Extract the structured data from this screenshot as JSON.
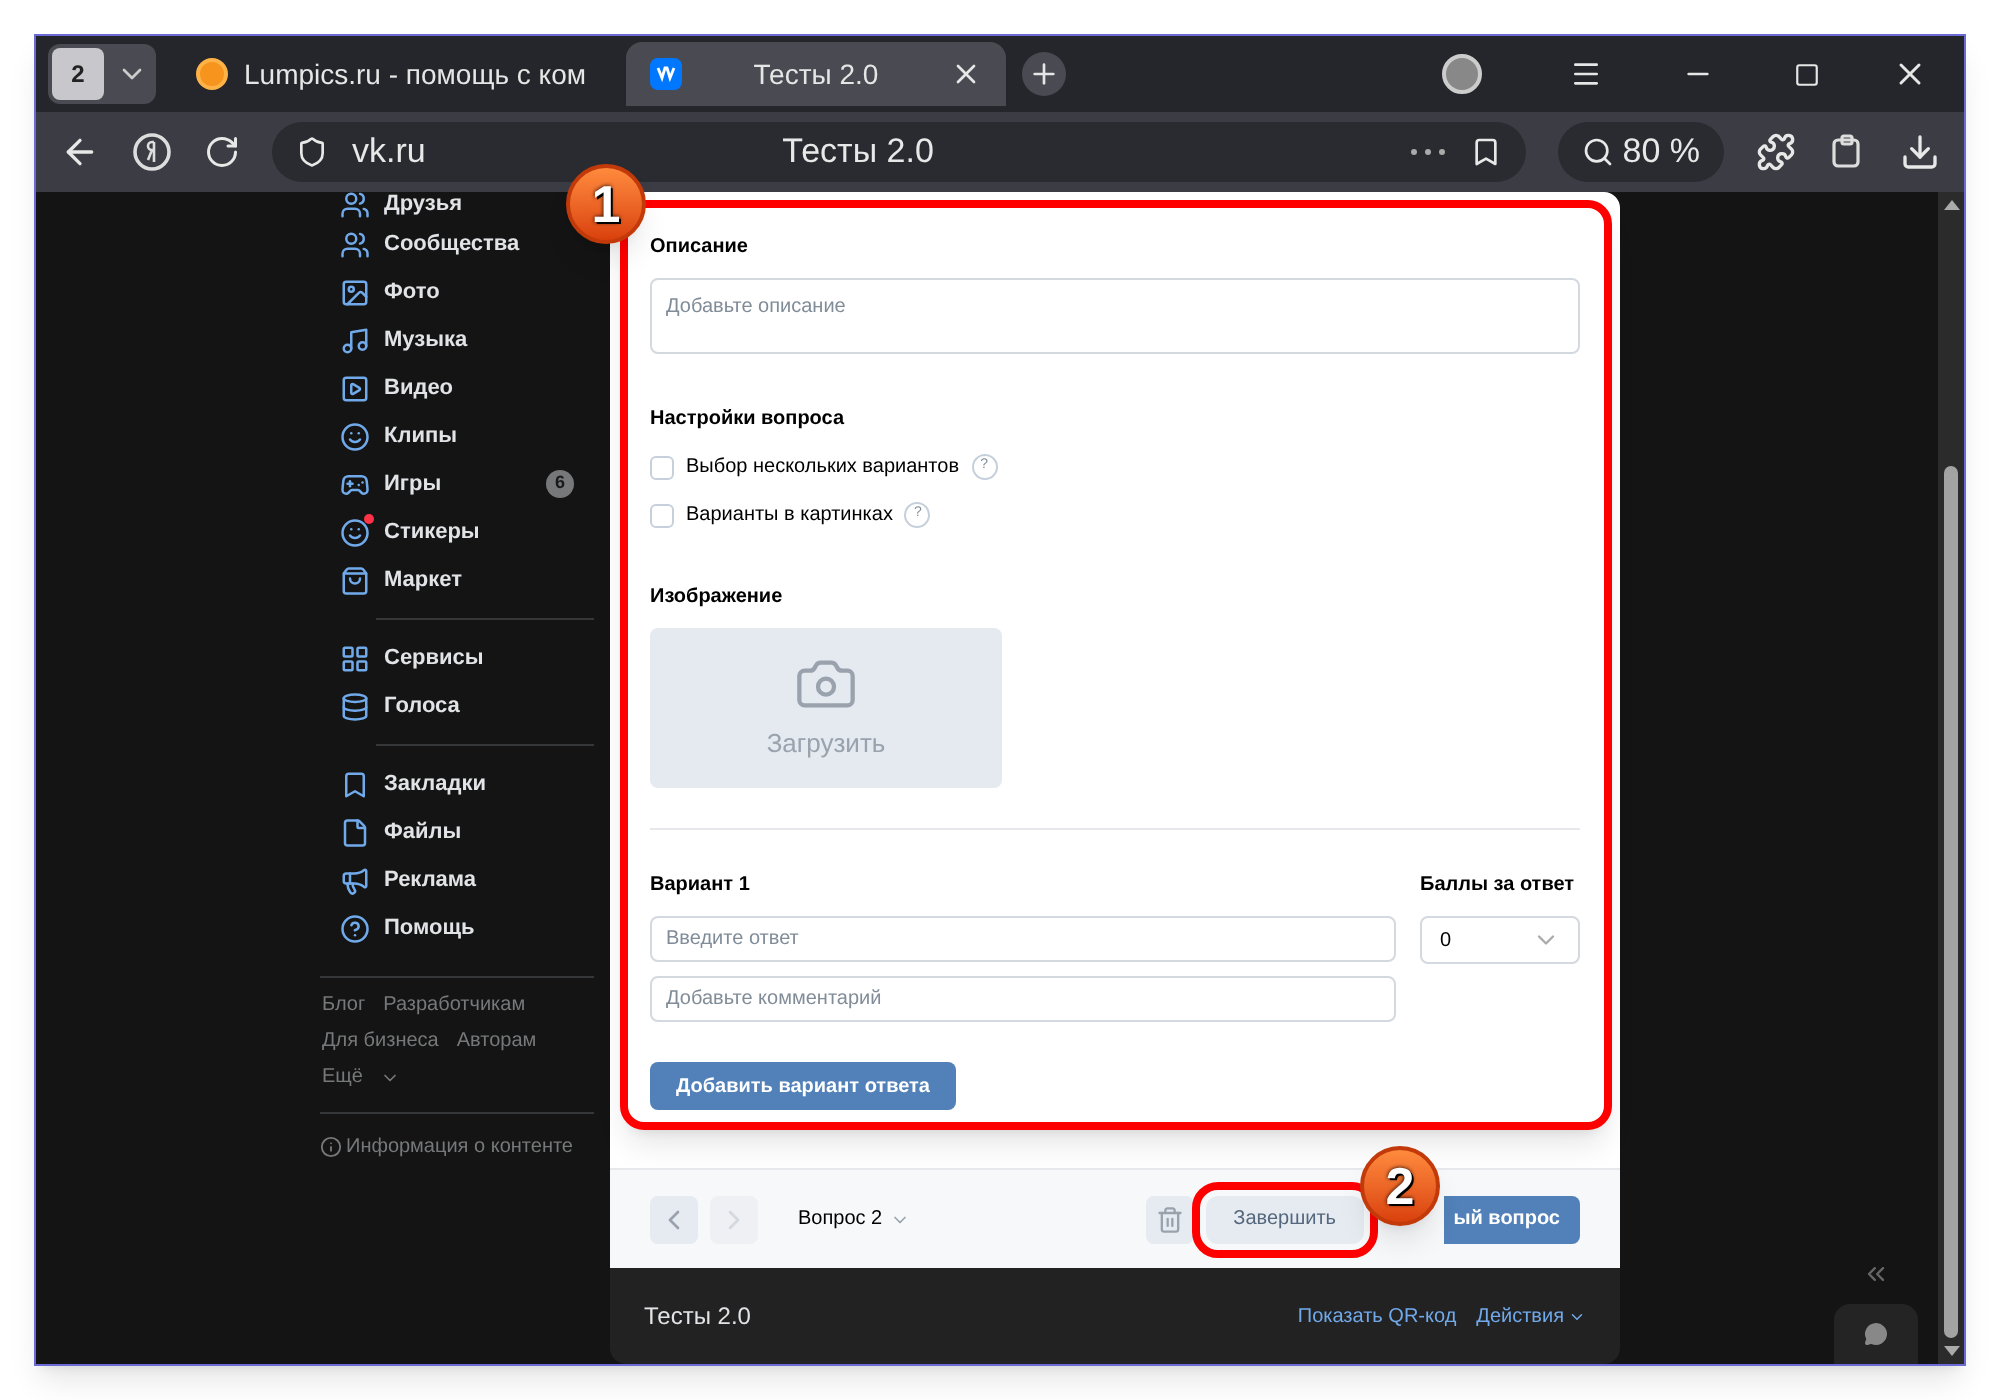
{
  "browser": {
    "tab_count": "2",
    "tabs": [
      {
        "title": "Lumpics.ru - помощь с ком",
        "selected": false,
        "kind": "lumpics"
      },
      {
        "title": "Тесты 2.0",
        "selected": true,
        "kind": "vk"
      }
    ],
    "address": "vk.ru",
    "page_title": "Тесты 2.0",
    "zoom": "80 %"
  },
  "sidebar": {
    "groups": [
      {
        "items": [
          {
            "label": "Друзья",
            "dot": false
          },
          {
            "label": "Сообщества",
            "dot": false
          },
          {
            "label": "Фото",
            "dot": false
          },
          {
            "label": "Музыка",
            "dot": false
          },
          {
            "label": "Видео",
            "dot": false
          },
          {
            "label": "Клипы",
            "dot": false
          },
          {
            "label": "Игры",
            "badge": "6",
            "dot": false
          },
          {
            "label": "Стикеры",
            "dot": true
          },
          {
            "label": "Маркет",
            "dot": false
          }
        ]
      },
      {
        "items": [
          {
            "label": "Сервисы",
            "dot": false
          },
          {
            "label": "Голоса",
            "dot": false
          }
        ]
      },
      {
        "items": [
          {
            "label": "Закладки",
            "dot": false
          },
          {
            "label": "Файлы",
            "dot": false
          },
          {
            "label": "Реклама",
            "dot": false
          },
          {
            "label": "Помощь",
            "dot": false
          }
        ]
      }
    ],
    "footer_links": [
      [
        "Блог",
        "Разработчикам"
      ],
      [
        "Для бизнеса",
        "Авторам"
      ],
      [
        "Ещё"
      ]
    ],
    "content_info": "Информация о контенте"
  },
  "form": {
    "description_label": "Описание",
    "description_placeholder": "Добавьте описание",
    "settings_label": "Настройки вопроса",
    "options": [
      {
        "label": "Выбор нескольких вариантов",
        "checked": false,
        "help": "?"
      },
      {
        "label": "Варианты в картинках",
        "checked": false,
        "help": "?"
      }
    ],
    "image_label": "Изображение",
    "upload": "Загрузить",
    "variant_label": "Вариант 1",
    "answer_placeholder": "Введите ответ",
    "comment_placeholder": "Добавьте комментарий",
    "points_label": "Баллы за ответ",
    "points_value": "0",
    "add_variant": "Добавить вариант ответа"
  },
  "bottom_bar": {
    "question": "Вопрос 2",
    "finish": "Завершить",
    "new_question": "ый вопрос"
  },
  "footer": {
    "title": "Тесты 2.0",
    "qr": "Показать QR-код",
    "actions": "Действия"
  },
  "annotations": [
    {
      "number": "1"
    },
    {
      "number": "2"
    }
  ]
}
